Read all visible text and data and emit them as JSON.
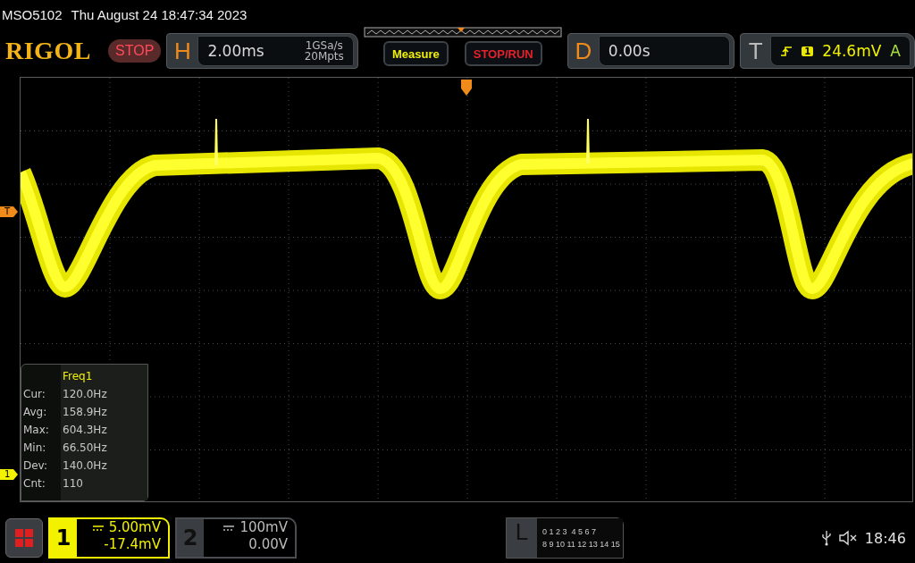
{
  "header": {
    "model": "MSO5102",
    "datetime": "Thu August 24 18:47:34 2023"
  },
  "toolbar": {
    "logo": "RIGOL",
    "run_state": {
      "label": "STOP",
      "kind": "stop"
    },
    "horizontal": {
      "letter": "H",
      "timebase": "2.00ms",
      "sample_rate": "1GSa/s",
      "memory_depth": "20Mpts"
    },
    "buttons": [
      {
        "label": "Measure",
        "kind": "measure"
      },
      {
        "label": "STOP/RUN",
        "kind": "run"
      }
    ],
    "delay": {
      "letter": "D",
      "value": "0.00s"
    },
    "trigger": {
      "letter": "T",
      "source": "1",
      "level": "24.6mV",
      "mode": "A"
    }
  },
  "screen": {
    "trigger_marker": "T",
    "channel_marker": "1",
    "measurement": {
      "title": "Freq1",
      "rows": [
        {
          "label": "Cur:",
          "value": "120.0Hz"
        },
        {
          "label": "Avg:",
          "value": "158.9Hz"
        },
        {
          "label": "Max:",
          "value": "604.3Hz"
        },
        {
          "label": "Min:",
          "value": "66.50Hz"
        },
        {
          "label": "Dev:",
          "value": "140.0Hz"
        },
        {
          "label": "Cnt:",
          "value": "110"
        }
      ]
    }
  },
  "channels": [
    {
      "number": "1",
      "scale": "5.00mV",
      "offset": "-17.4mV",
      "selected": true
    },
    {
      "number": "2",
      "scale": "100mV",
      "offset": "0.00V",
      "selected": false
    }
  ],
  "logic": {
    "letter": "L",
    "rows": [
      "0 1 2 3  4 5 6 7",
      "8 9 10 11 12 13 14 15"
    ]
  },
  "status": {
    "time": "18:46"
  }
}
